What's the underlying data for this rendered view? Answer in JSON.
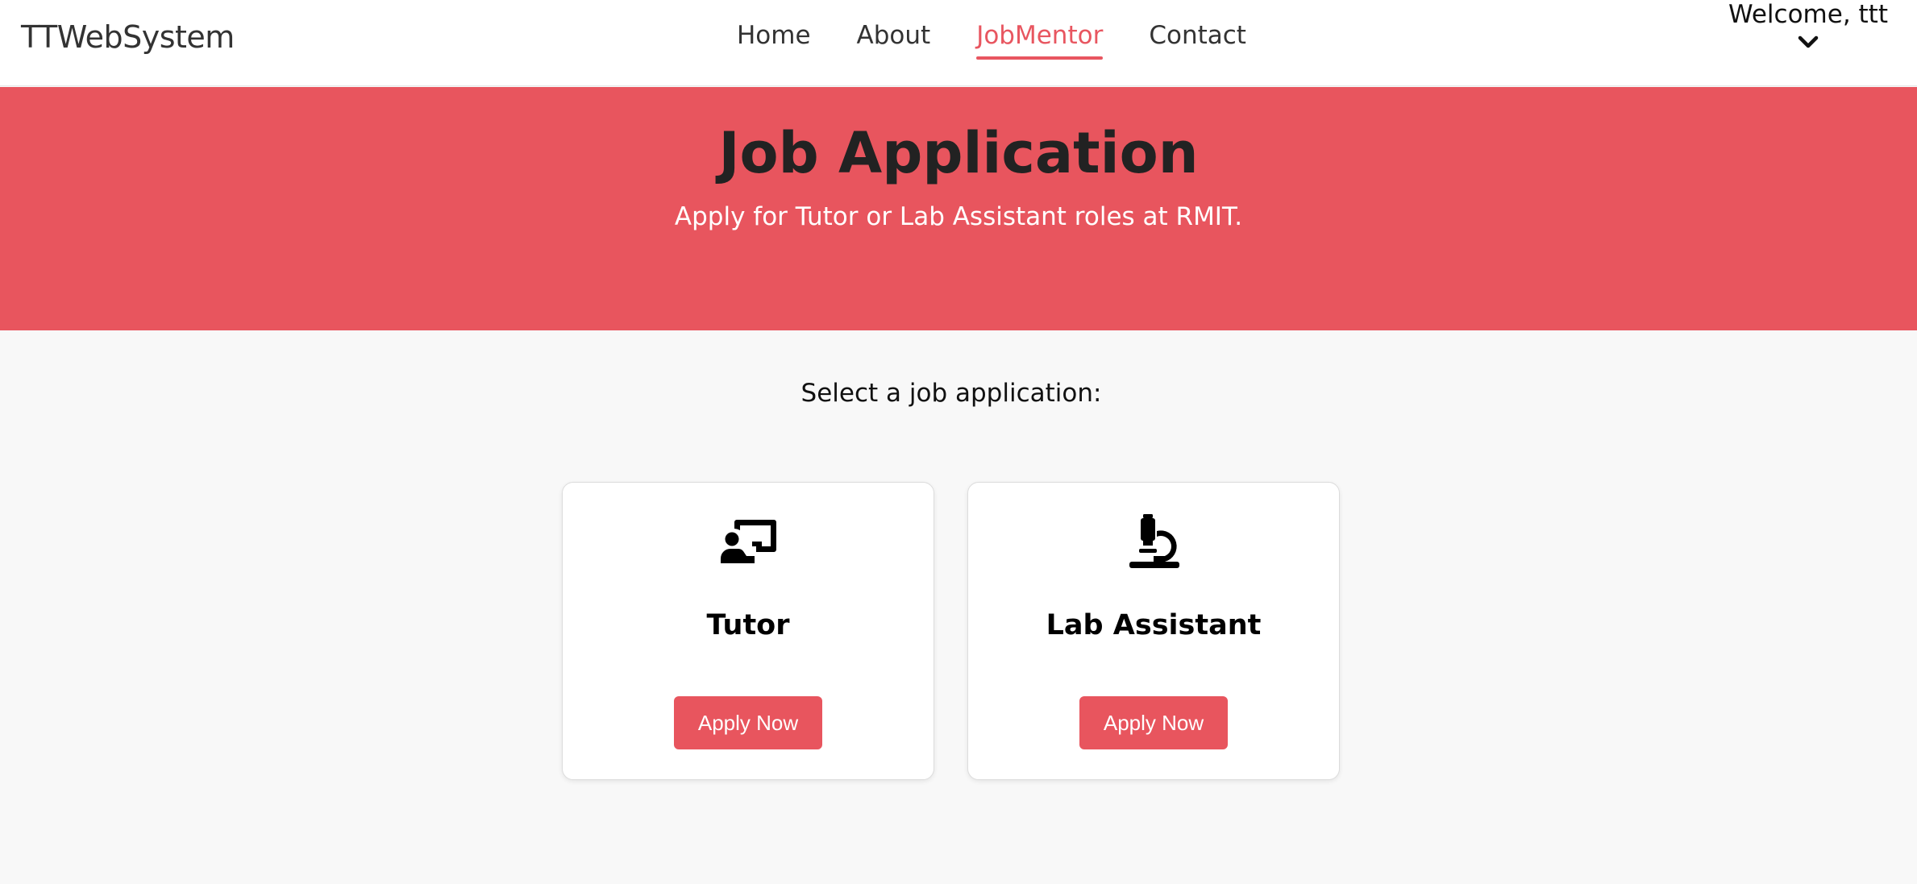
{
  "brand": "TTWebSystem",
  "nav": {
    "items": [
      {
        "label": "Home",
        "active": false
      },
      {
        "label": "About",
        "active": false
      },
      {
        "label": "JobMentor",
        "active": true
      },
      {
        "label": "Contact",
        "active": false
      }
    ],
    "accent_color": "#e85660"
  },
  "user": {
    "welcome": "Welcome, ttt",
    "menu_icon": "chevron-down-icon"
  },
  "hero": {
    "title": "Job Application",
    "subtitle": "Apply for Tutor or Lab Assistant roles at RMIT.",
    "background_color": "#e8555e"
  },
  "main": {
    "prompt": "Select a job application:",
    "cards": [
      {
        "icon": "teacher-board-icon",
        "title": "Tutor",
        "button_label": "Apply Now"
      },
      {
        "icon": "microscope-icon",
        "title": "Lab Assistant",
        "button_label": "Apply Now"
      }
    ]
  }
}
